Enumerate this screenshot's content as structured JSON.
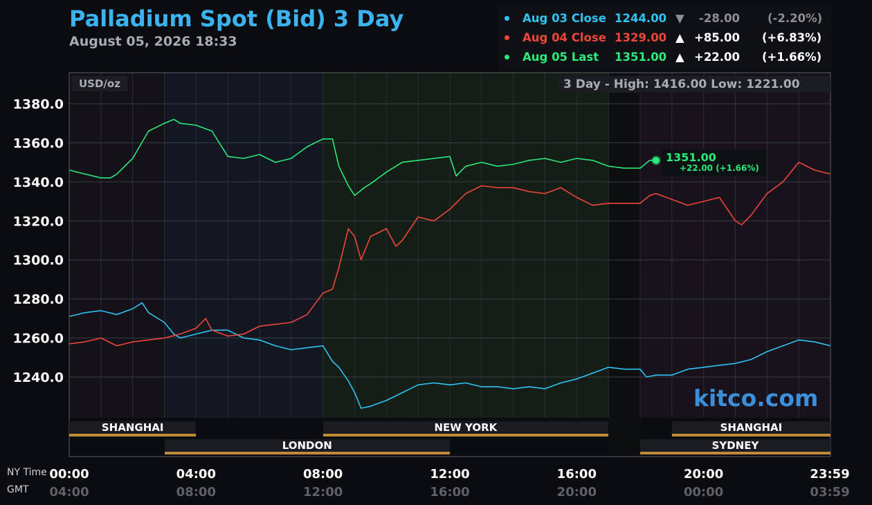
{
  "header": {
    "title": "Palladium Spot (Bid) 3 Day",
    "timestamp": "August 05, 2026 18:33"
  },
  "legend": [
    {
      "label": "Aug 03 Close",
      "price": "1244.00",
      "arrow": "▼",
      "change": "-28.00",
      "pct": "(-2.20%)",
      "color": "#2ec4f5",
      "value_color": "#8b8e95"
    },
    {
      "label": "Aug 04 Close",
      "price": "1329.00",
      "arrow": "▲",
      "change": "+85.00",
      "pct": "(+6.83%)",
      "color": "#f0463a",
      "value_color": "#ffffff"
    },
    {
      "label": "Aug 05 Last",
      "price": "1351.00",
      "arrow": "▲",
      "change": "+22.00",
      "pct": "(+1.66%)",
      "color": "#2bea7a",
      "value_color": "#ffffff"
    }
  ],
  "unit_label": "USD/oz",
  "range_label": "3 Day - High: 1416.00  Low: 1221.00",
  "watermark": "kitco.com",
  "last_callout": {
    "value": "1351.00",
    "change": "+22.00 (+1.66%)"
  },
  "timezones": {
    "ny": "NY Time",
    "gmt": "GMT"
  },
  "sessions": [
    {
      "name": "SHANGHAI",
      "start": 0,
      "end": 4,
      "row": 1
    },
    {
      "name": "NEW YORK",
      "start": 8,
      "end": 17,
      "row": 1
    },
    {
      "name": "SHANGHAI",
      "start": 19,
      "end": 24,
      "row": 1
    },
    {
      "name": "LONDON",
      "start": 3,
      "end": 12,
      "row": 2
    },
    {
      "name": "SYDNEY",
      "start": 18,
      "end": 24,
      "row": 2
    }
  ],
  "chart_data": {
    "type": "line",
    "ylabel": "USD/oz",
    "ylim": [
      1215,
      1395
    ],
    "xlim": [
      0,
      24
    ],
    "y_ticks": [
      1380,
      1360,
      1340,
      1320,
      1300,
      1280,
      1260,
      1240
    ],
    "y_tick_labels": [
      "1380.0",
      "1360.0",
      "1340.0",
      "1320.0",
      "1300.0",
      "1280.0",
      "1260.0",
      "1240.0"
    ],
    "x_ticks": [
      0,
      4,
      8,
      12,
      16,
      20,
      23.98
    ],
    "x_tick_labels_ny": [
      "00:00",
      "04:00",
      "08:00",
      "12:00",
      "16:00",
      "20:00",
      "23:59"
    ],
    "x_tick_labels_gmt": [
      "04:00",
      "08:00",
      "12:00",
      "16:00",
      "20:00",
      "00:00",
      "03:59"
    ],
    "high": 1416.0,
    "low": 1221.0,
    "series": [
      {
        "name": "Aug 03 Close",
        "color": "#2ec4f5",
        "x": [
          0,
          0.5,
          1,
          1.5,
          2,
          2.3,
          2.5,
          3,
          3.3,
          3.5,
          4,
          4.5,
          5,
          5.5,
          6,
          6.5,
          7,
          7.5,
          8,
          8.3,
          8.5,
          8.8,
          9,
          9.2,
          9.5,
          10,
          10.5,
          11,
          11.5,
          12,
          12.5,
          13,
          13.5,
          14,
          14.5,
          15,
          15.5,
          16,
          16.5,
          17,
          17.5,
          18,
          18.2,
          18.5,
          19,
          19.5,
          20,
          20.5,
          21,
          21.5,
          22,
          22.5,
          23,
          23.5,
          24
        ],
        "y": [
          1271,
          1273,
          1274,
          1272,
          1275,
          1278,
          1273,
          1268,
          1262,
          1260,
          1262,
          1264,
          1264,
          1260,
          1259,
          1256,
          1254,
          1255,
          1256,
          1248,
          1245,
          1238,
          1232,
          1224,
          1225,
          1228,
          1232,
          1236,
          1237,
          1236,
          1237,
          1235,
          1235,
          1234,
          1235,
          1234,
          1237,
          1239,
          1242,
          1245,
          1244,
          1244,
          1240,
          1241,
          1241,
          1244,
          1245,
          1246,
          1247,
          1249,
          1253,
          1256,
          1259,
          1258,
          1256
        ]
      },
      {
        "name": "Aug 04 Close",
        "color": "#f0463a",
        "x": [
          0,
          0.5,
          1,
          1.5,
          2,
          2.5,
          3,
          3.5,
          4,
          4.3,
          4.5,
          5,
          5.5,
          6,
          6.5,
          7,
          7.5,
          8,
          8.3,
          8.5,
          8.8,
          9,
          9.2,
          9.5,
          10,
          10.3,
          10.5,
          11,
          11.5,
          12,
          12.5,
          13,
          13.5,
          14,
          14.5,
          15,
          15.5,
          16,
          16.5,
          17,
          17.5,
          18,
          18.3,
          18.5,
          19,
          19.5,
          20,
          20.5,
          21,
          21.2,
          21.5,
          22,
          22.5,
          23,
          23.5,
          24
        ],
        "y": [
          1257,
          1258,
          1260,
          1256,
          1258,
          1259,
          1260,
          1262,
          1265,
          1270,
          1264,
          1261,
          1262,
          1266,
          1267,
          1268,
          1272,
          1283,
          1285,
          1296,
          1316,
          1312,
          1300,
          1312,
          1316,
          1307,
          1310,
          1322,
          1320,
          1326,
          1334,
          1338,
          1337,
          1337,
          1335,
          1334,
          1337,
          1332,
          1328,
          1329,
          1329,
          1329,
          1333,
          1334,
          1331,
          1328,
          1330,
          1332,
          1320,
          1318,
          1323,
          1334,
          1340,
          1350,
          1346,
          1344
        ]
      },
      {
        "name": "Aug 05 Last",
        "color": "#2bea7a",
        "x": [
          0,
          0.5,
          1,
          1.3,
          1.5,
          2,
          2.5,
          3,
          3.3,
          3.5,
          4,
          4.5,
          5,
          5.5,
          6,
          6.5,
          7,
          7.5,
          8,
          8.3,
          8.5,
          8.8,
          9,
          9.3,
          9.5,
          10,
          10.5,
          11,
          11.5,
          12,
          12.2,
          12.5,
          13,
          13.5,
          14,
          14.5,
          15,
          15.5,
          16,
          16.5,
          17,
          17.5,
          18,
          18.3,
          18.5
        ],
        "y": [
          1346,
          1344,
          1342,
          1342,
          1344,
          1352,
          1366,
          1370,
          1372,
          1370,
          1369,
          1366,
          1353,
          1352,
          1354,
          1350,
          1352,
          1358,
          1362,
          1362,
          1348,
          1338,
          1333,
          1337,
          1339,
          1345,
          1350,
          1351,
          1352,
          1353,
          1343,
          1348,
          1350,
          1348,
          1349,
          1351,
          1352,
          1350,
          1352,
          1351,
          1348,
          1347,
          1347,
          1351,
          1351
        ]
      }
    ]
  }
}
